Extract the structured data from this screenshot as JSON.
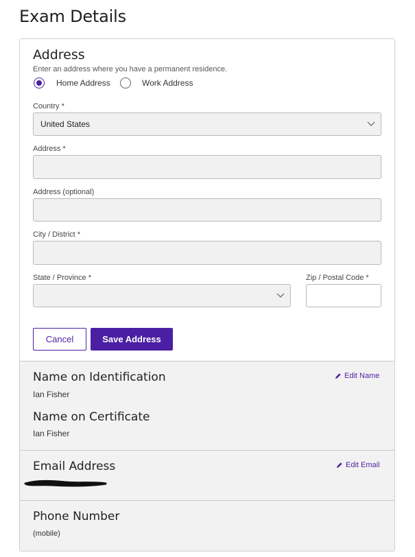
{
  "page": {
    "title": "Exam Details"
  },
  "address": {
    "heading": "Address",
    "instructions": "Enter an address where you have a permanent residence.",
    "radio_home": "Home Address",
    "radio_work": "Work Address",
    "selected": "home",
    "country_label": "Country *",
    "country_value": "United States",
    "address_label": "Address *",
    "address_value": "",
    "address2_label": "Address (optional)",
    "address2_value": "",
    "city_label": "City / District *",
    "city_value": "",
    "state_label": "State / Province *",
    "state_value": "",
    "zip_label": "Zip / Postal Code *",
    "zip_value": "",
    "cancel_label": "Cancel",
    "save_label": "Save Address"
  },
  "identity": {
    "name_id_heading": "Name on Identification",
    "name_id_value": "Ian Fisher",
    "edit_name_label": "Edit Name",
    "name_cert_heading": "Name on Certificate",
    "name_cert_value": "Ian Fisher"
  },
  "email": {
    "heading": "Email Address",
    "edit_label": "Edit Email"
  },
  "phone": {
    "heading": "Phone Number",
    "type": "(mobile)"
  },
  "colors": {
    "accent": "#4b1fa3",
    "section_bg": "#f2f2f2",
    "field_bg": "#f1f1f1"
  },
  "icons": [
    "chevron-down-icon",
    "pencil-icon",
    "redaction-scribble"
  ]
}
